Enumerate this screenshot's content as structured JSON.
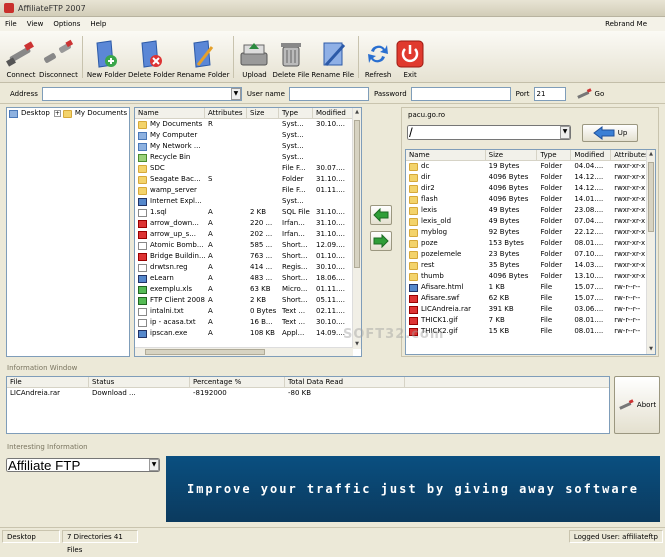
{
  "window": {
    "title": "AffiliateFTP 2007"
  },
  "menu": {
    "items": [
      "File",
      "View",
      "Options",
      "Help"
    ],
    "rebrand": "Rebrand Me"
  },
  "toolbar": {
    "connect": "Connect",
    "disconnect": "Disconnect",
    "new_folder": "New Folder",
    "delete_folder": "Delete Folder",
    "rename_folder": "Rename Folder",
    "upload": "Upload",
    "delete_file": "Delete File",
    "rename_file": "Rename File",
    "refresh": "Refresh",
    "exit": "Exit"
  },
  "connection": {
    "address_label": "Address",
    "address_value": "",
    "user_label": "User name",
    "user_value": "",
    "password_label": "Password",
    "password_value": "",
    "port_label": "Port",
    "port_value": "21",
    "go_label": "Go"
  },
  "tree": {
    "items": [
      {
        "label": "Desktop",
        "icon": "desktop-icon",
        "level": 0
      },
      {
        "label": "My Documents",
        "icon": "folder-icon",
        "level": 1
      },
      {
        "label": "My Computer",
        "icon": "computer-icon",
        "level": 1
      },
      {
        "label": "My Network Places",
        "icon": "network-icon",
        "level": 1
      },
      {
        "label": "Recycle Bin",
        "icon": "recycle-icon",
        "level": 1
      },
      {
        "label": "SDC",
        "icon": "folder-icon",
        "level": 1
      },
      {
        "label": "Seagate Backup",
        "icon": "folder-icon",
        "level": 1
      },
      {
        "label": "wamp_server",
        "icon": "folder-icon",
        "level": 1
      }
    ]
  },
  "local": {
    "columns": [
      "Name",
      "Attributes",
      "Size",
      "Type",
      "Modified"
    ],
    "rows": [
      [
        "My Documents",
        "R",
        "",
        "Syst...",
        "30.10...."
      ],
      [
        "My Computer",
        "",
        "",
        "Syst...",
        ""
      ],
      [
        "My Network ...",
        "",
        "",
        "Syst...",
        ""
      ],
      [
        "Recycle Bin",
        "",
        "",
        "Syst...",
        ""
      ],
      [
        "SDC",
        "",
        "",
        "File F...",
        "30.07...."
      ],
      [
        "Seagate Bac...",
        "S",
        "",
        "Folder",
        "31.10...."
      ],
      [
        "wamp_server",
        "",
        "",
        "File F...",
        "01.11...."
      ],
      [
        "Internet Expl...",
        "",
        "",
        "Syst...",
        ""
      ],
      [
        "1.sql",
        "A",
        "2 KB",
        "SQL File",
        "31.10...."
      ],
      [
        "arrow_down...",
        "A",
        "220 ...",
        "Irfan...",
        "31.10...."
      ],
      [
        "arrow_up_s...",
        "A",
        "202 ...",
        "Irfan...",
        "31.10...."
      ],
      [
        "Atomic Bomb...",
        "A",
        "585 ...",
        "Short...",
        "12.09...."
      ],
      [
        "Bridge Buildin...",
        "A",
        "763 ...",
        "Short...",
        "01.10...."
      ],
      [
        "drwtsn.reg",
        "A",
        "414 ...",
        "Regis...",
        "30.10...."
      ],
      [
        "eLearn",
        "A",
        "483 ...",
        "Short...",
        "18.06...."
      ],
      [
        "exemplu.xls",
        "A",
        "63 KB",
        "Micro...",
        "01.11...."
      ],
      [
        "FTP Client 2008",
        "A",
        "2 KB",
        "Short...",
        "05.11...."
      ],
      [
        "intalni.txt",
        "A",
        "0 Bytes",
        "Text ...",
        "02.11...."
      ],
      [
        "ip - acasa.txt",
        "A",
        "16 B...",
        "Text ...",
        "30.10...."
      ],
      [
        "ipscan.exe",
        "A",
        "108 KB",
        "Appl...",
        "14.09...."
      ]
    ]
  },
  "remote": {
    "host": "pacu.go.ro",
    "path": "/",
    "up_label": "Up",
    "columns": [
      "Name",
      "Size",
      "Type",
      "Modified",
      "Attributes"
    ],
    "rows": [
      [
        "dc",
        "19 Bytes",
        "Folder",
        "04.04....",
        "rwxr-xr-x"
      ],
      [
        "dir",
        "4096 Bytes",
        "Folder",
        "14.12....",
        "rwxr-xr-x"
      ],
      [
        "dir2",
        "4096 Bytes",
        "Folder",
        "14.12....",
        "rwxr-xr-x"
      ],
      [
        "flash",
        "4096 Bytes",
        "Folder",
        "14.01....",
        "rwxr-xr-x"
      ],
      [
        "lexis",
        "49 Bytes",
        "Folder",
        "23.08....",
        "rwxr-xr-x"
      ],
      [
        "lexis_old",
        "49 Bytes",
        "Folder",
        "07.04....",
        "rwxr-xr-x"
      ],
      [
        "myblog",
        "92 Bytes",
        "Folder",
        "22.12....",
        "rwxr-xr-x"
      ],
      [
        "poze",
        "153 Bytes",
        "Folder",
        "08.01....",
        "rwxr-xr-x"
      ],
      [
        "pozelemele",
        "23 Bytes",
        "Folder",
        "07.10....",
        "rwxr-xr-x"
      ],
      [
        "rest",
        "35 Bytes",
        "Folder",
        "14.03....",
        "rwxr-xr-x"
      ],
      [
        "thumb",
        "4096 Bytes",
        "Folder",
        "13.10....",
        "rwxr-xr-x"
      ],
      [
        "Afisare.html",
        "1 KB",
        "File",
        "15.07....",
        "rw-r--r--"
      ],
      [
        "Afisare.swf",
        "62 KB",
        "File",
        "15.07....",
        "rw-r--r--"
      ],
      [
        "LICAndreia.rar",
        "391 KB",
        "File",
        "03.06....",
        "rw-r--r--"
      ],
      [
        "THICK1.gif",
        "7 KB",
        "File",
        "08.01....",
        "rw-r--r--"
      ],
      [
        "THICK2.gif",
        "15 KB",
        "File",
        "08.01....",
        "rw-r--r--"
      ]
    ]
  },
  "info": {
    "title": "Information Window",
    "columns": [
      "File",
      "Status",
      "Percentage %",
      "Total Data Read"
    ],
    "rows": [
      [
        "LICAndreia.rar",
        "Download ...",
        "-8192000",
        "-80 KB"
      ]
    ],
    "abort_label": "Abort"
  },
  "interesting": {
    "title": "Interesting Information",
    "select_value": "Affiliate FTP",
    "banner_text": "Improve your traffic just by giving away software"
  },
  "watermark": "SOFT32.com",
  "status": {
    "location": "Desktop",
    "counts": "7 Directories 41 Files",
    "user": "Logged User: affiliateftp"
  },
  "colors": {
    "banner": "#0b4670",
    "panel_border": "#7f9db9"
  }
}
